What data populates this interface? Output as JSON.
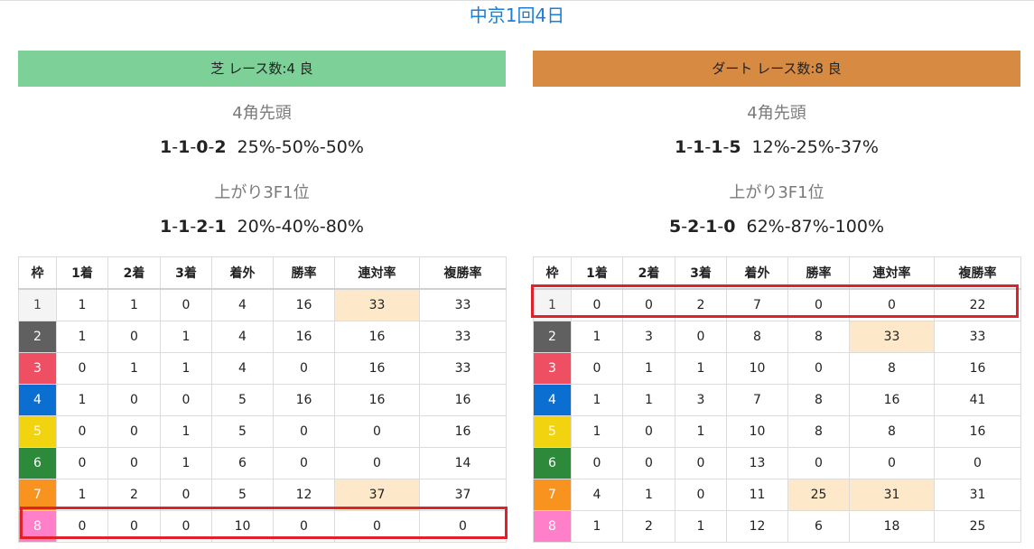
{
  "title": "中京1回4日",
  "headers": [
    "枠",
    "1着",
    "2着",
    "3着",
    "着外",
    "勝率",
    "連対率",
    "複勝率"
  ],
  "frame_colors": [
    "#f4f4f4",
    "#606060",
    "#ee4f62",
    "#0a6fd1",
    "#f2d30f",
    "#2c8a3a",
    "#f7931e",
    "#ff7fc9"
  ],
  "highlight_color": "#fde9c9",
  "turf": {
    "heading": "芝 レース数:4 良",
    "bar_color": "#7dd097",
    "corner_label": "4角先頭",
    "corner_parts": [
      "1",
      "1",
      "0",
      "2"
    ],
    "corner_pct": "25%-50%-50%",
    "last3f_label": "上がり3F1位",
    "last3f_parts": [
      "1",
      "1",
      "2",
      "1"
    ],
    "last3f_pct": "20%-40%-80%",
    "rows": [
      [
        "1",
        "1",
        "1",
        "0",
        "4",
        "16",
        "33",
        "33"
      ],
      [
        "2",
        "1",
        "0",
        "1",
        "4",
        "16",
        "16",
        "33"
      ],
      [
        "3",
        "0",
        "1",
        "1",
        "4",
        "0",
        "16",
        "33"
      ],
      [
        "4",
        "1",
        "0",
        "0",
        "5",
        "16",
        "16",
        "16"
      ],
      [
        "5",
        "0",
        "0",
        "1",
        "5",
        "0",
        "0",
        "16"
      ],
      [
        "6",
        "0",
        "0",
        "1",
        "6",
        "0",
        "0",
        "14"
      ],
      [
        "7",
        "1",
        "2",
        "0",
        "5",
        "12",
        "37",
        "37"
      ],
      [
        "8",
        "0",
        "0",
        "0",
        "10",
        "0",
        "0",
        "0"
      ]
    ],
    "highlighted_cells": [
      [
        0,
        6
      ],
      [
        6,
        6
      ]
    ],
    "boxed_row": 7
  },
  "dirt": {
    "heading": "ダート レース数:8 良",
    "bar_color": "#d68a42",
    "corner_label": "4角先頭",
    "corner_parts": [
      "1",
      "1",
      "1",
      "5"
    ],
    "corner_pct": "12%-25%-37%",
    "last3f_label": "上がり3F1位",
    "last3f_parts": [
      "5",
      "2",
      "1",
      "0"
    ],
    "last3f_pct": "62%-87%-100%",
    "rows": [
      [
        "1",
        "0",
        "0",
        "2",
        "7",
        "0",
        "0",
        "22"
      ],
      [
        "2",
        "1",
        "3",
        "0",
        "8",
        "8",
        "33",
        "33"
      ],
      [
        "3",
        "0",
        "1",
        "1",
        "10",
        "0",
        "8",
        "16"
      ],
      [
        "4",
        "1",
        "1",
        "3",
        "7",
        "8",
        "16",
        "41"
      ],
      [
        "5",
        "1",
        "0",
        "1",
        "10",
        "8",
        "8",
        "16"
      ],
      [
        "6",
        "0",
        "0",
        "0",
        "13",
        "0",
        "0",
        "0"
      ],
      [
        "7",
        "4",
        "1",
        "0",
        "11",
        "25",
        "31",
        "31"
      ],
      [
        "8",
        "1",
        "2",
        "1",
        "12",
        "6",
        "18",
        "25"
      ]
    ],
    "highlighted_cells": [
      [
        1,
        6
      ],
      [
        6,
        5
      ],
      [
        6,
        6
      ]
    ],
    "boxed_row": 0
  }
}
